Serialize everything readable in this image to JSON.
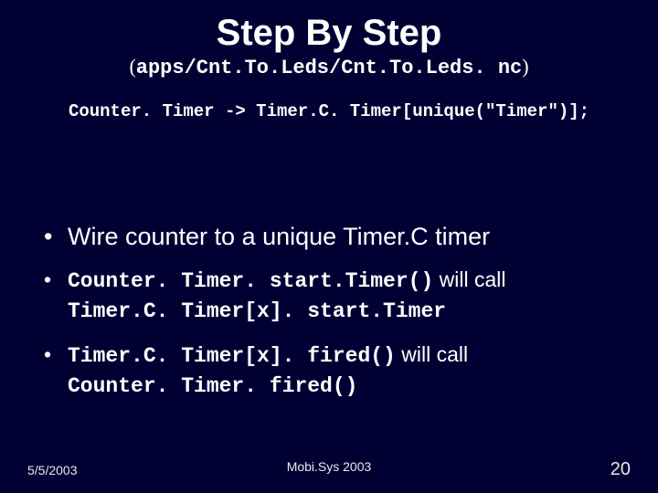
{
  "title": "Step By Step",
  "subtitle_path": "apps/Cnt.To.Leds/Cnt.To.Leds. nc",
  "code_line": "Counter. Timer -> Timer.C. Timer[unique(\"Timer\")];",
  "bullets": {
    "b1": "Wire counter to a unique Timer.C timer",
    "b2a_code": "Counter. Timer. start.Timer()",
    "b2a_tail": " will call ",
    "b2a_code2": "Timer.C. Timer[x]. start.Timer",
    "b2b_code": "Timer.C. Timer[x]. fired()",
    "b2b_tail": " will call ",
    "b2b_code2": "Counter. Timer. fired()"
  },
  "footer": {
    "date": "5/5/2003",
    "venue": "Mobi.Sys 2003",
    "page": "20"
  }
}
